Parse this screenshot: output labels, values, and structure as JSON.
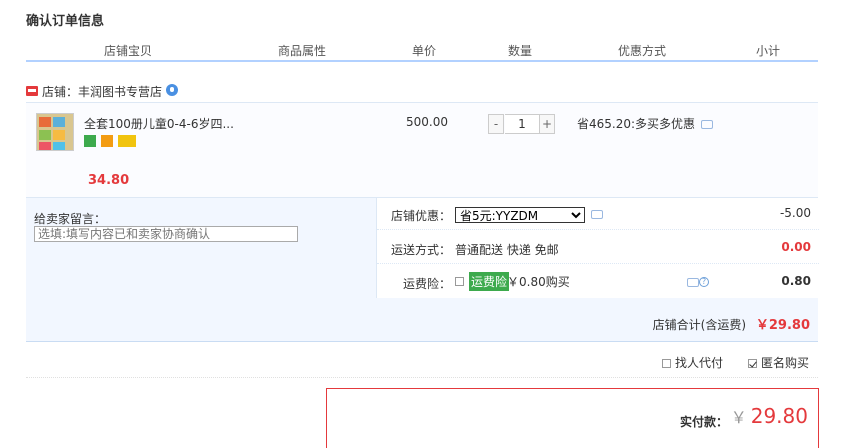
{
  "page_title": "确认订单信息",
  "columns": [
    "店铺宝贝",
    "商品属性",
    "单价",
    "数量",
    "优惠方式",
    "小计"
  ],
  "shop": {
    "label": "店铺：丰润图书专营店"
  },
  "item": {
    "title": "全套100册儿童0-4-6岁四...",
    "unit_price": "500.00",
    "quantity": "1",
    "minus": "-",
    "plus": "+",
    "promo": "省465.20:多买多优惠",
    "subtotal": "34.80"
  },
  "message": {
    "label": "给卖家留言：",
    "placeholder": "选填:填写内容已和卖家协商确认"
  },
  "discount": {
    "label": "店铺优惠：",
    "selected": "省5元:YYZDM",
    "amount": "-5.00"
  },
  "shipping": {
    "label": "运送方式：",
    "value": "普通配送 快递 免邮",
    "amount": "0.00"
  },
  "insurance": {
    "label": "运费险：",
    "tag": "运费险",
    "price": "￥0.80购买",
    "amount": "0.80"
  },
  "shop_total": {
    "label": "店铺合计(含运费)",
    "value": "￥29.80"
  },
  "options": {
    "proxy_pay": "找人代付",
    "anonymous": "匿名购买"
  },
  "payment": {
    "label": "实付款：",
    "currency": "￥",
    "amount": "29.80"
  },
  "colors": {
    "accent": "#e4393c",
    "header_line": "#b2d1ff",
    "panel": "#f2f7ff"
  }
}
